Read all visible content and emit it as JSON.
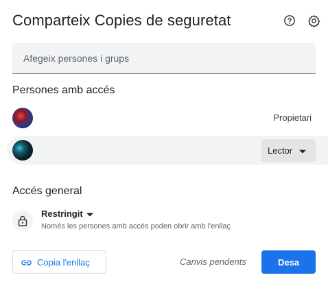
{
  "dialog": {
    "title": "Comparteix Copies de seguretat",
    "icons": {
      "help": "help-circle-icon",
      "settings": "gear-icon"
    }
  },
  "add_people": {
    "placeholder": "Afegeix persones i grups",
    "value": ""
  },
  "people_access": {
    "title": "Persones amb accés",
    "people": [
      {
        "avatar": "user-avatar",
        "role": "Propietari"
      },
      {
        "avatar": "user-avatar",
        "role": "Lector"
      }
    ]
  },
  "general_access": {
    "title": "Accés general",
    "icon": "lock-icon",
    "mode": "Restringit",
    "description": "Només les persones amb accés poden obrir amb l'enllaç"
  },
  "footer": {
    "copy_link_label": "Copia l'enllaç",
    "copy_link_icon": "link-icon",
    "pending_text": "Canvis pendents",
    "save_label": "Desa"
  },
  "colors": {
    "accent": "#1a73e8",
    "field_bg": "#f1f3f4",
    "text_primary": "#202124",
    "text_secondary": "#5f6368"
  }
}
